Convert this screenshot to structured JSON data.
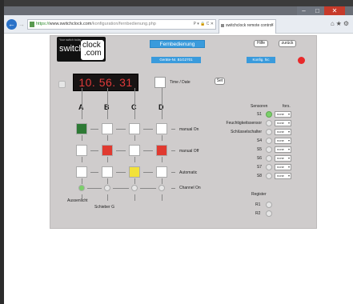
{
  "browser": {
    "url_scheme": "https://",
    "url_host": "www.switchclock.com",
    "url_path": "/konfiguration/fernbedienung.php",
    "url_tools": "P ▾ 🔒 C ✕",
    "tab_title": "switchclock remote control"
  },
  "logo": {
    "tagline": "Your switch today",
    "word1": "switch",
    "word2": "clock",
    "word3": ".com"
  },
  "header": {
    "title": "Fernbedienung",
    "device": "Geräte-Nr. B1G2701",
    "config": "Konfig. hic",
    "help": "Hilfe",
    "back": "zurück"
  },
  "clock": {
    "time": "10. 56. 31",
    "date_label": "Time / Date",
    "set_label": "Set"
  },
  "matrix": {
    "columns": [
      "A",
      "B",
      "C",
      "D"
    ],
    "row_labels": [
      "manual On",
      "manual Off",
      "Automatic",
      "Channel On"
    ],
    "cells": [
      [
        "#2e7a35",
        "#ffffff",
        "#ffffff",
        "#ffffff"
      ],
      [
        "#ffffff",
        "#e03a30",
        "#ffffff",
        "#e03a30"
      ],
      [
        "#ffffff",
        "#ffffff",
        "#f2e23a",
        "#ffffff"
      ]
    ],
    "channel_on": [
      "#7bd06a",
      "#e6e6e6",
      "#e6e6e6",
      "#e6e6e6"
    ],
    "bottom_left_label": "Aussenlicht",
    "bottom_mid_label": "Schieber G"
  },
  "sensors": {
    "title": "Sensoren",
    "fors_title": "fors.",
    "items": [
      {
        "label": "S1",
        "on": true,
        "value": "none"
      },
      {
        "label": "Feuchtigkeitssensor",
        "on": false,
        "value": "none"
      },
      {
        "label": "Schlüsselschalter",
        "on": false,
        "value": "none"
      },
      {
        "label": "S4",
        "on": false,
        "value": "none"
      },
      {
        "label": "S5",
        "on": false,
        "value": "none"
      },
      {
        "label": "S6",
        "on": false,
        "value": "none"
      },
      {
        "label": "S7",
        "on": false,
        "value": "none"
      },
      {
        "label": "S8",
        "on": false,
        "value": "none"
      }
    ]
  },
  "register": {
    "title": "Register",
    "items": [
      "R1",
      "R2"
    ]
  },
  "colors": {
    "accent": "#3a9bdc",
    "status_red": "#e8292a",
    "panel_bg": "#cfcccc"
  }
}
